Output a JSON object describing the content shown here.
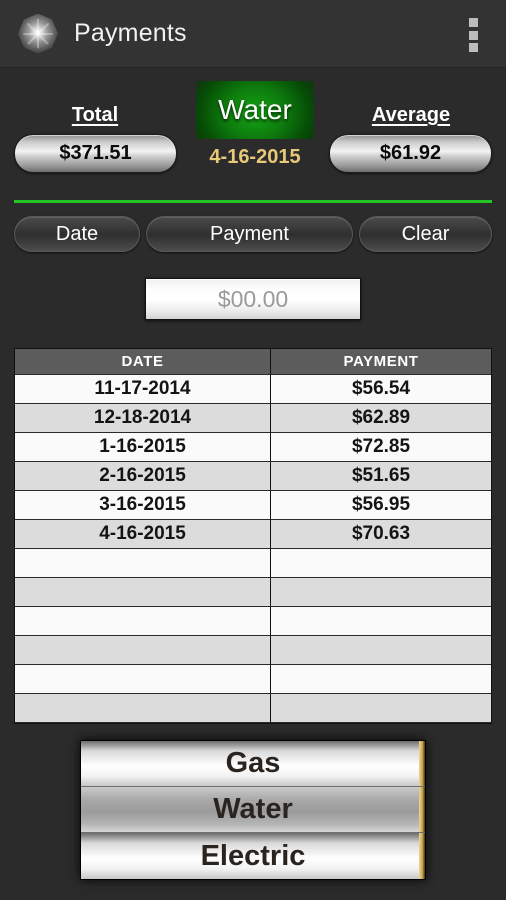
{
  "app": {
    "title": "Payments",
    "icon": "starburst-octagon-icon",
    "overflow_icon": "overflow-menu-icon",
    "accent_green": "#22c522",
    "accent_gold": "#e8c879"
  },
  "summary": {
    "total_label": "Total",
    "total_value": "$371.51",
    "category": "Water",
    "date": "4-16-2015",
    "average_label": "Average",
    "average_value": "$61.92"
  },
  "actions": {
    "date_label": "Date",
    "payment_label": "Payment",
    "clear_label": "Clear"
  },
  "amount_input": {
    "value": "",
    "placeholder": "$00.00"
  },
  "table": {
    "columns": [
      "DATE",
      "PAYMENT"
    ],
    "rows": [
      {
        "date": "11-17-2014",
        "payment": "$56.54"
      },
      {
        "date": "12-18-2014",
        "payment": "$62.89"
      },
      {
        "date": "1-16-2015",
        "payment": "$72.85"
      },
      {
        "date": "2-16-2015",
        "payment": "$51.65"
      },
      {
        "date": "3-16-2015",
        "payment": "$56.95"
      },
      {
        "date": "4-16-2015",
        "payment": "$70.63"
      },
      {
        "date": "",
        "payment": ""
      },
      {
        "date": "",
        "payment": ""
      },
      {
        "date": "",
        "payment": ""
      },
      {
        "date": "",
        "payment": ""
      },
      {
        "date": "",
        "payment": ""
      },
      {
        "date": "",
        "payment": ""
      }
    ]
  },
  "categories": {
    "items": [
      {
        "label": "Gas",
        "selected": false
      },
      {
        "label": "Water",
        "selected": true
      },
      {
        "label": "Electric",
        "selected": false
      }
    ]
  }
}
